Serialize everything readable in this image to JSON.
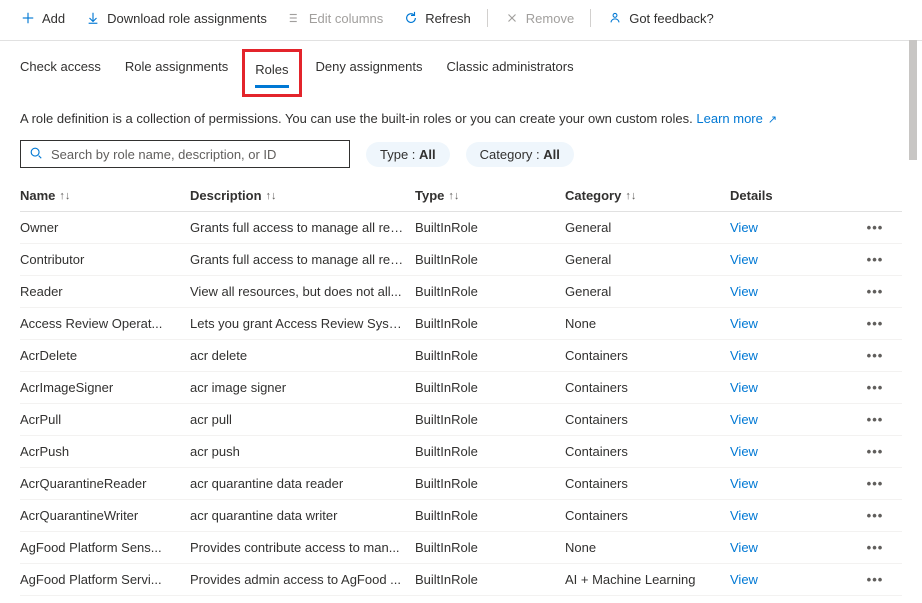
{
  "toolbar": {
    "add": "Add",
    "download": "Download role assignments",
    "edit_columns": "Edit columns",
    "refresh": "Refresh",
    "remove": "Remove",
    "feedback": "Got feedback?"
  },
  "tabs": {
    "check_access": "Check access",
    "role_assignments": "Role assignments",
    "roles": "Roles",
    "deny_assignments": "Deny assignments",
    "classic_admins": "Classic administrators"
  },
  "description": {
    "text": "A role definition is a collection of permissions. You can use the built-in roles or you can create your own custom roles.",
    "learn_more": "Learn more"
  },
  "search": {
    "placeholder": "Search by role name, description, or ID"
  },
  "filters": {
    "type_label": "Type : ",
    "type_value": "All",
    "category_label": "Category : ",
    "category_value": "All"
  },
  "columns": {
    "name": "Name",
    "description": "Description",
    "type": "Type",
    "category": "Category",
    "details": "Details"
  },
  "view_label": "View",
  "rows": [
    {
      "name": "Owner",
      "description": "Grants full access to manage all res...",
      "type": "BuiltInRole",
      "category": "General"
    },
    {
      "name": "Contributor",
      "description": "Grants full access to manage all res...",
      "type": "BuiltInRole",
      "category": "General"
    },
    {
      "name": "Reader",
      "description": "View all resources, but does not all...",
      "type": "BuiltInRole",
      "category": "General"
    },
    {
      "name": "Access Review Operat...",
      "description": "Lets you grant Access Review Syste...",
      "type": "BuiltInRole",
      "category": "None"
    },
    {
      "name": "AcrDelete",
      "description": "acr delete",
      "type": "BuiltInRole",
      "category": "Containers"
    },
    {
      "name": "AcrImageSigner",
      "description": "acr image signer",
      "type": "BuiltInRole",
      "category": "Containers"
    },
    {
      "name": "AcrPull",
      "description": "acr pull",
      "type": "BuiltInRole",
      "category": "Containers"
    },
    {
      "name": "AcrPush",
      "description": "acr push",
      "type": "BuiltInRole",
      "category": "Containers"
    },
    {
      "name": "AcrQuarantineReader",
      "description": "acr quarantine data reader",
      "type": "BuiltInRole",
      "category": "Containers"
    },
    {
      "name": "AcrQuarantineWriter",
      "description": "acr quarantine data writer",
      "type": "BuiltInRole",
      "category": "Containers"
    },
    {
      "name": "AgFood Platform Sens...",
      "description": "Provides contribute access to man...",
      "type": "BuiltInRole",
      "category": "None"
    },
    {
      "name": "AgFood Platform Servi...",
      "description": "Provides admin access to AgFood ...",
      "type": "BuiltInRole",
      "category": "AI + Machine Learning"
    }
  ]
}
